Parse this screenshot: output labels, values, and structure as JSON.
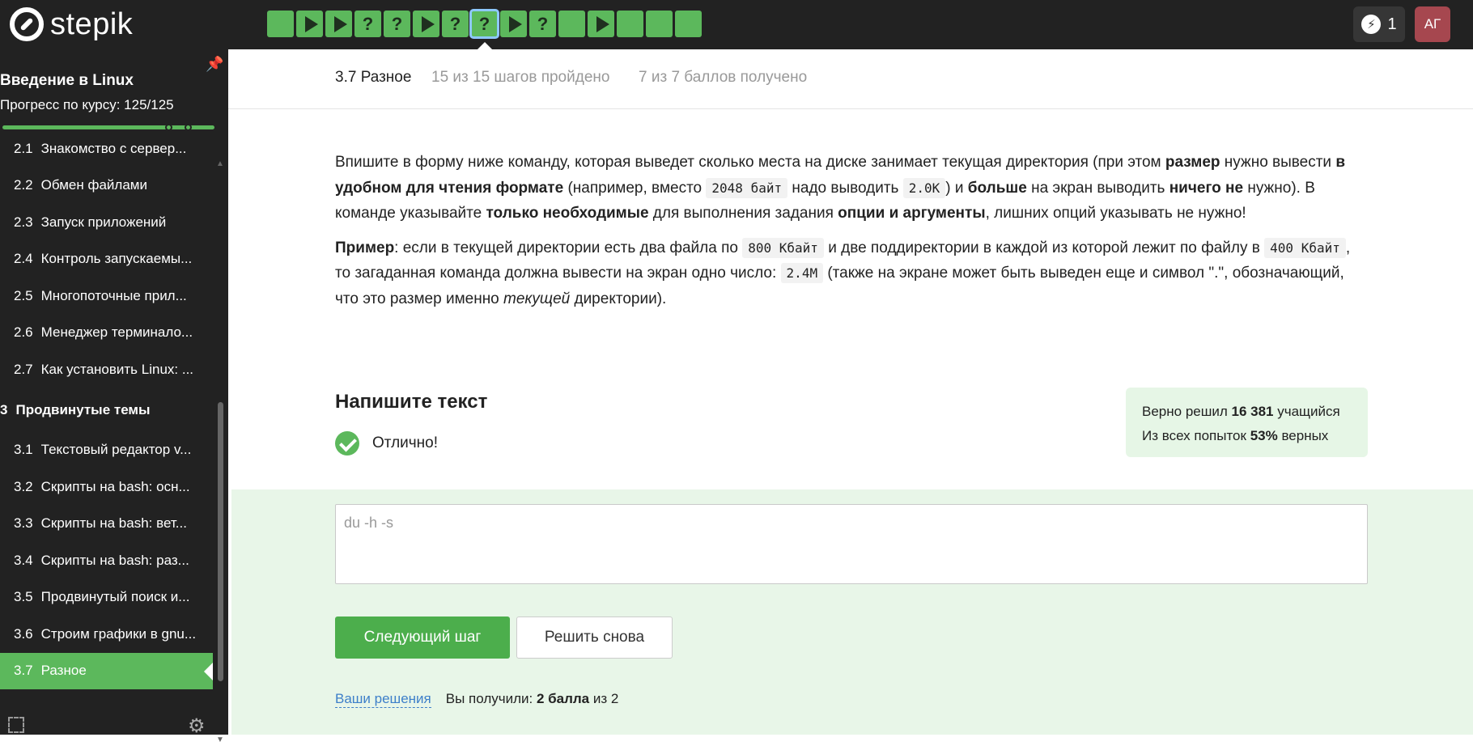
{
  "brand": {
    "name": "stepik"
  },
  "steps": [
    {
      "kind": "text"
    },
    {
      "kind": "video"
    },
    {
      "kind": "video"
    },
    {
      "kind": "quiz",
      "label": "?"
    },
    {
      "kind": "quiz",
      "label": "?"
    },
    {
      "kind": "video"
    },
    {
      "kind": "quiz",
      "label": "?"
    },
    {
      "kind": "quiz",
      "label": "?",
      "active": true
    },
    {
      "kind": "video"
    },
    {
      "kind": "quiz",
      "label": "?"
    },
    {
      "kind": "text"
    },
    {
      "kind": "video"
    },
    {
      "kind": "text"
    },
    {
      "kind": "text"
    },
    {
      "kind": "text"
    }
  ],
  "header": {
    "energy_count": "1",
    "avatar_initials": "АГ"
  },
  "sidebar": {
    "course_title": "Введение в Linux",
    "progress_label": "Прогресс по курсу:  125/125",
    "items_top": [
      {
        "num": "2.1",
        "label": "Знакомство с сервер..."
      },
      {
        "num": "2.2",
        "label": "Обмен файлами"
      },
      {
        "num": "2.3",
        "label": "Запуск приложений"
      },
      {
        "num": "2.4",
        "label": "Контроль запускаемы..."
      },
      {
        "num": "2.5",
        "label": "Многопоточные прил..."
      },
      {
        "num": "2.6",
        "label": "Менеджер терминало..."
      },
      {
        "num": "2.7",
        "label": "Как установить Linux: ..."
      }
    ],
    "section": {
      "num": "3",
      "label": "Продвинутые темы"
    },
    "items_bottom": [
      {
        "num": "3.1",
        "label": "Текстовый редактор v..."
      },
      {
        "num": "3.2",
        "label": "Скрипты на bash: осн..."
      },
      {
        "num": "3.3",
        "label": "Скрипты на bash: вет..."
      },
      {
        "num": "3.4",
        "label": "Скрипты на bash: раз..."
      },
      {
        "num": "3.5",
        "label": "Продвинутый поиск и..."
      },
      {
        "num": "3.6",
        "label": "Строим графики в gnu..."
      },
      {
        "num": "3.7",
        "label": "Разное"
      }
    ]
  },
  "lesson": {
    "title": "3.7 Разное",
    "steps_passed": "15 из 15 шагов пройдено",
    "score": "7 из 7 баллов  получено"
  },
  "task": {
    "p1": [
      "Впишите в форму ниже команду, которая выведет сколько места на диске занимает текущая директория (при этом ",
      "размер",
      " нужно вывести ",
      "в удобном для чтения формате",
      " (например, вместо ",
      "2048 байт",
      " надо выводить ",
      "2.0K",
      ") и ",
      "больше",
      " на экран выводить ",
      "ничего не",
      " нужно). В команде указывайте ",
      "только необходимые",
      " для выполнения задания ",
      "опции и аргументы",
      ", лишних опций указывать не нужно!"
    ],
    "p2": [
      "Пример",
      ": если в текущей директории есть два файла по ",
      "800 Кбайт",
      " и две поддиректории в каждой из которой лежит по файлу в ",
      "400 Кбайт",
      ", то загаданная команда должна вывести на экран одно число: ",
      "2.4M",
      " (также на экране может быть выведен еще и символ \".\", обозначающий, что это размер именно ",
      "текущей",
      " директории)."
    ],
    "heading": "Напишите текст",
    "status": "Отлично!",
    "stats_line1_pre": "Верно решил ",
    "stats_line1_num": "16 381",
    "stats_line1_post": " учащийся",
    "stats_line2_pre": "Из всех попыток ",
    "stats_line2_num": "53%",
    "stats_line2_post": " верных",
    "answer": "du -h -s",
    "next_button": "Следующий шаг",
    "retry_button": "Решить снова",
    "solutions_link": "Ваши решения",
    "result_pre": "Вы получили: ",
    "result_bold": "2 балла",
    "result_post": " из 2"
  }
}
